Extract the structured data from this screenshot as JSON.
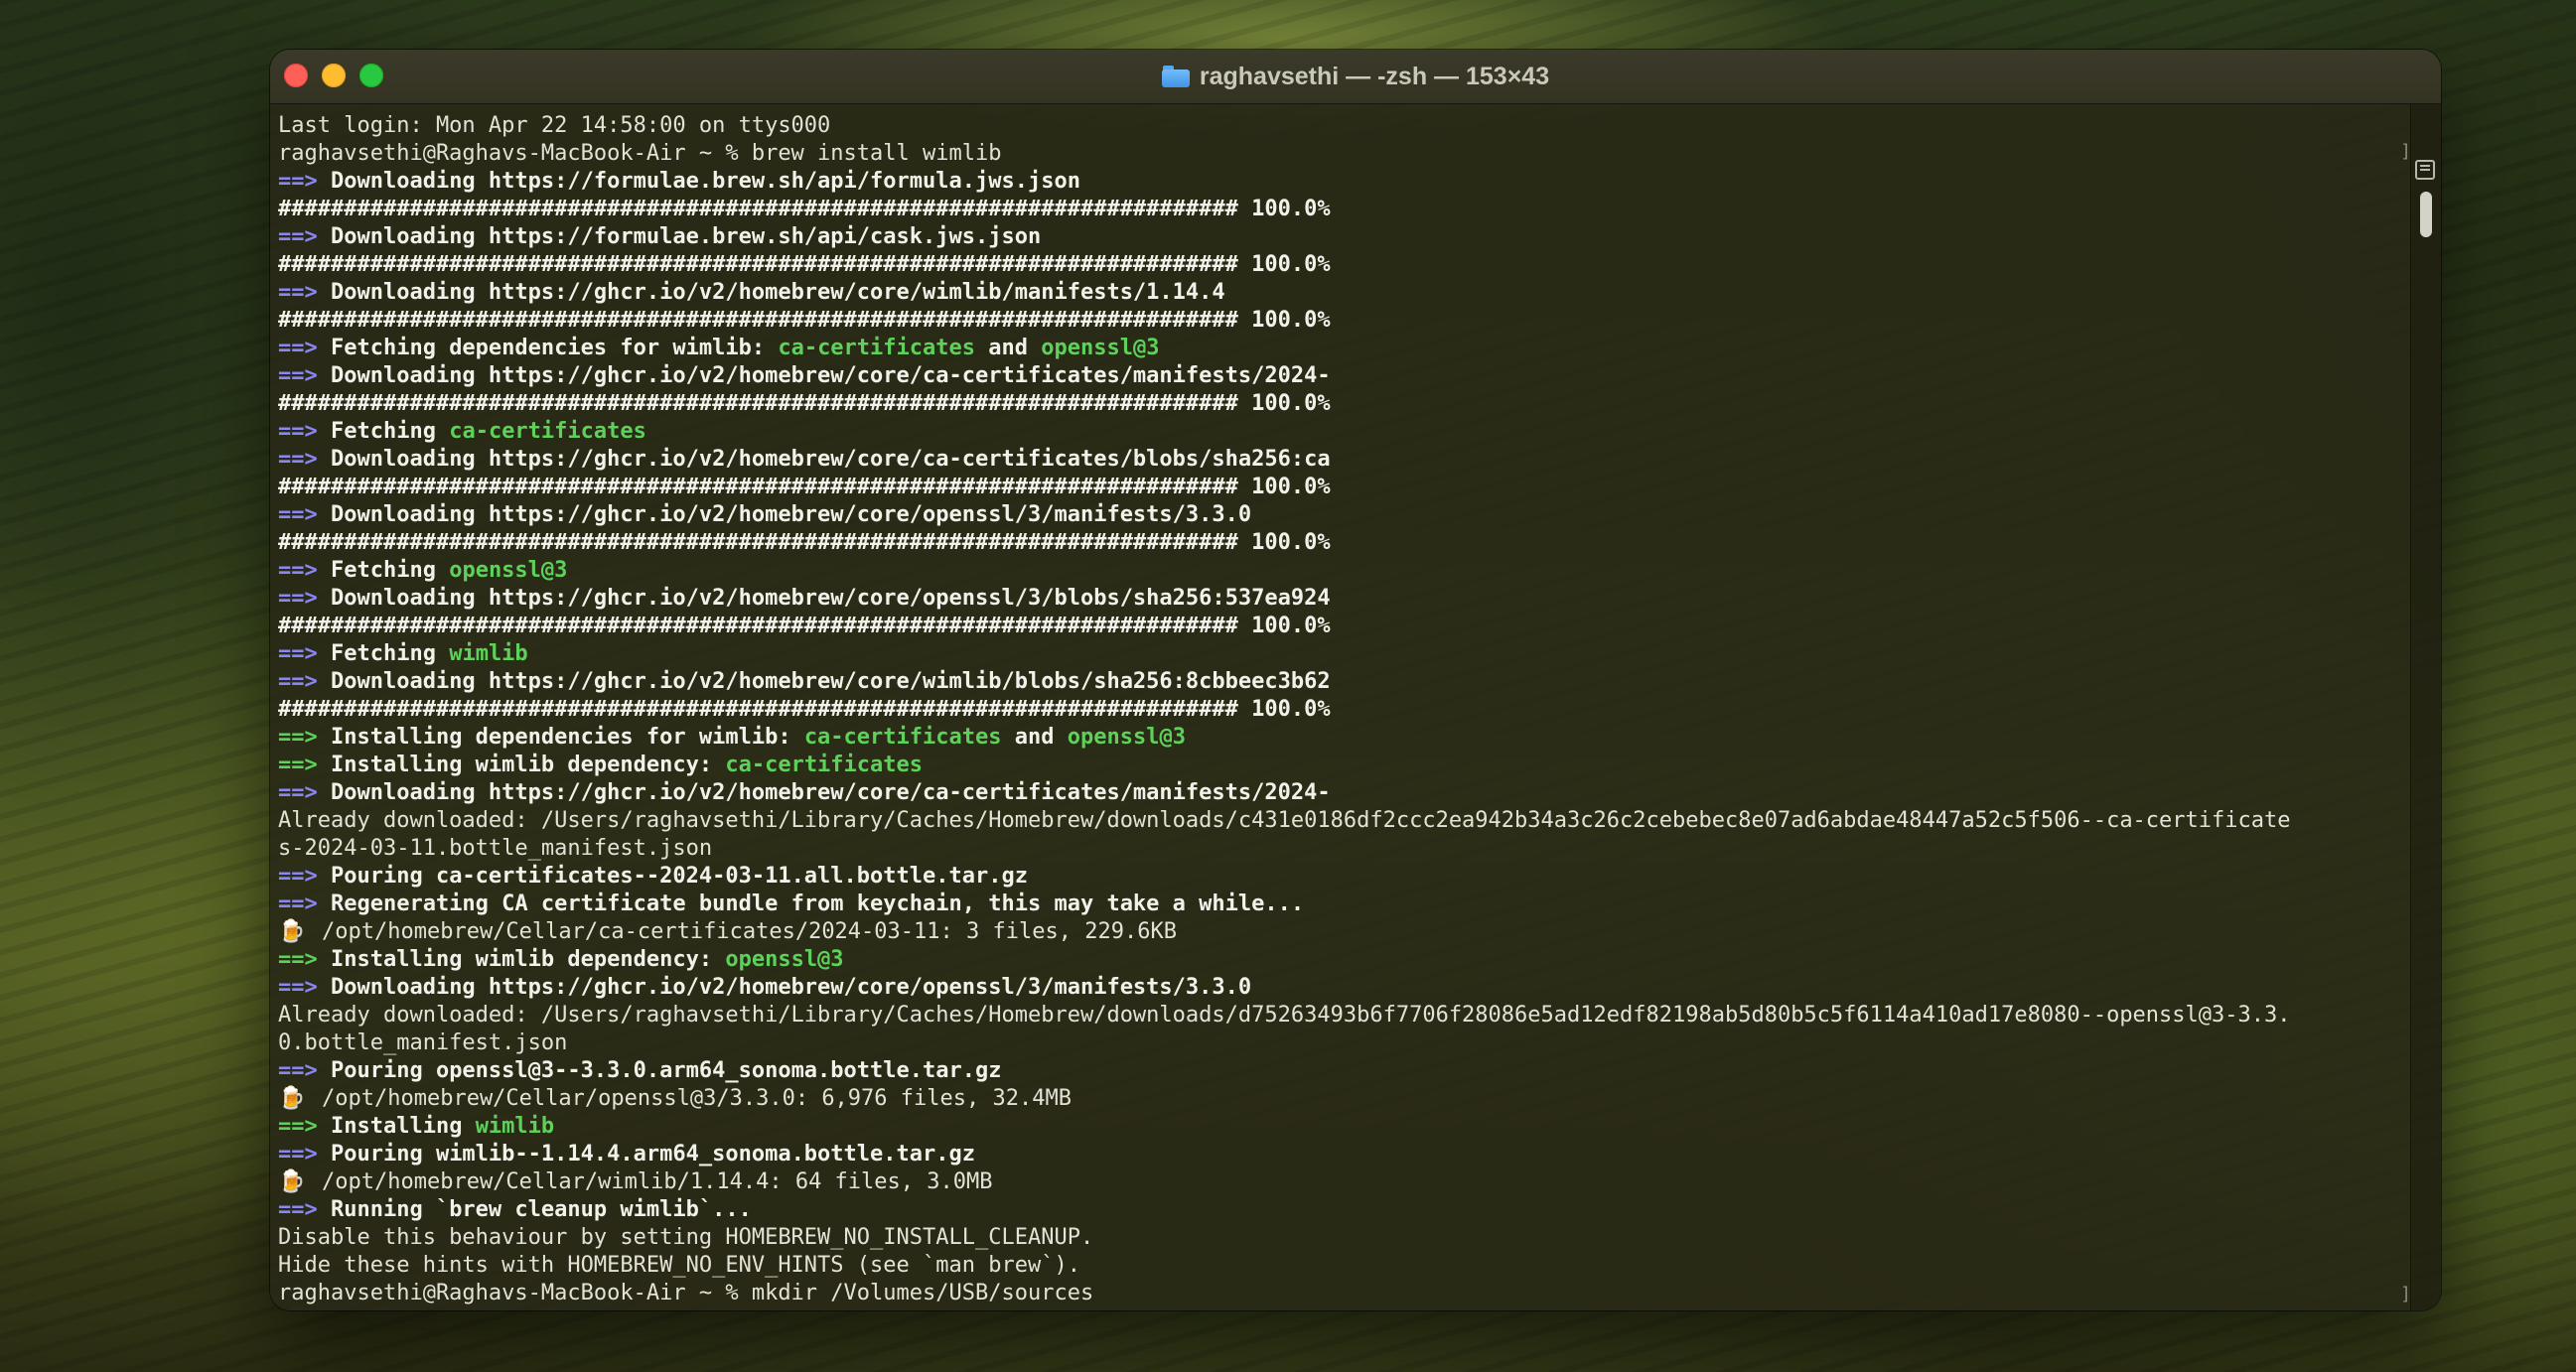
{
  "window": {
    "title": "raghavsethi — -zsh — 153×43",
    "folder_icon": "folder-icon"
  },
  "colors": {
    "arrow": "#8a86f4",
    "highlight": "#5ed15a",
    "text": "#e4e2d6"
  },
  "terminal": {
    "lines": [
      [
        {
          "t": "plain",
          "s": "Last login: Mon Apr 22 14:58:00 on ttys000"
        }
      ],
      [
        {
          "t": "plain",
          "s": "raghavsethi@Raghavs-MacBook-Air ~ % brew install wimlib"
        }
      ],
      [
        {
          "t": "arrow",
          "s": "==> "
        },
        {
          "t": "bold",
          "s": "Downloading https://formulae.brew.sh/api/formula.jws.json"
        }
      ],
      [
        {
          "t": "bold",
          "s": "######################################################################### 100.0%"
        }
      ],
      [
        {
          "t": "arrow",
          "s": "==> "
        },
        {
          "t": "bold",
          "s": "Downloading https://formulae.brew.sh/api/cask.jws.json"
        }
      ],
      [
        {
          "t": "bold",
          "s": "######################################################################### 100.0%"
        }
      ],
      [
        {
          "t": "arrow",
          "s": "==> "
        },
        {
          "t": "bold",
          "s": "Downloading https://ghcr.io/v2/homebrew/core/wimlib/manifests/1.14.4"
        }
      ],
      [
        {
          "t": "bold",
          "s": "######################################################################### 100.0%"
        }
      ],
      [
        {
          "t": "arrow",
          "s": "==> "
        },
        {
          "t": "bold",
          "s": "Fetching dependencies for wimlib: "
        },
        {
          "t": "green",
          "s": "ca-certificates"
        },
        {
          "t": "bold",
          "s": " and "
        },
        {
          "t": "green",
          "s": "openssl@3"
        }
      ],
      [
        {
          "t": "arrow",
          "s": "==> "
        },
        {
          "t": "bold",
          "s": "Downloading https://ghcr.io/v2/homebrew/core/ca-certificates/manifests/2024-"
        }
      ],
      [
        {
          "t": "bold",
          "s": "######################################################################### 100.0%"
        }
      ],
      [
        {
          "t": "arrow",
          "s": "==> "
        },
        {
          "t": "bold",
          "s": "Fetching "
        },
        {
          "t": "green",
          "s": "ca-certificates"
        }
      ],
      [
        {
          "t": "arrow",
          "s": "==> "
        },
        {
          "t": "bold",
          "s": "Downloading https://ghcr.io/v2/homebrew/core/ca-certificates/blobs/sha256:ca"
        }
      ],
      [
        {
          "t": "bold",
          "s": "######################################################################### 100.0%"
        }
      ],
      [
        {
          "t": "arrow",
          "s": "==> "
        },
        {
          "t": "bold",
          "s": "Downloading https://ghcr.io/v2/homebrew/core/openssl/3/manifests/3.3.0"
        }
      ],
      [
        {
          "t": "bold",
          "s": "######################################################################### 100.0%"
        }
      ],
      [
        {
          "t": "arrow",
          "s": "==> "
        },
        {
          "t": "bold",
          "s": "Fetching "
        },
        {
          "t": "green",
          "s": "openssl@3"
        }
      ],
      [
        {
          "t": "arrow",
          "s": "==> "
        },
        {
          "t": "bold",
          "s": "Downloading https://ghcr.io/v2/homebrew/core/openssl/3/blobs/sha256:537ea924"
        }
      ],
      [
        {
          "t": "bold",
          "s": "######################################################################### 100.0%"
        }
      ],
      [
        {
          "t": "arrow",
          "s": "==> "
        },
        {
          "t": "bold",
          "s": "Fetching "
        },
        {
          "t": "green",
          "s": "wimlib"
        }
      ],
      [
        {
          "t": "arrow",
          "s": "==> "
        },
        {
          "t": "bold",
          "s": "Downloading https://ghcr.io/v2/homebrew/core/wimlib/blobs/sha256:8cbbeec3b62"
        }
      ],
      [
        {
          "t": "bold",
          "s": "######################################################################### 100.0%"
        }
      ],
      [
        {
          "t": "green",
          "s": "==> "
        },
        {
          "t": "bold",
          "s": "Installing dependencies for wimlib: "
        },
        {
          "t": "green",
          "s": "ca-certificates"
        },
        {
          "t": "bold",
          "s": " and "
        },
        {
          "t": "green",
          "s": "openssl@3"
        }
      ],
      [
        {
          "t": "green",
          "s": "==> "
        },
        {
          "t": "bold",
          "s": "Installing wimlib dependency: "
        },
        {
          "t": "green",
          "s": "ca-certificates"
        }
      ],
      [
        {
          "t": "arrow",
          "s": "==> "
        },
        {
          "t": "bold",
          "s": "Downloading https://ghcr.io/v2/homebrew/core/ca-certificates/manifests/2024-"
        }
      ],
      [
        {
          "t": "plain",
          "s": "Already downloaded: /Users/raghavsethi/Library/Caches/Homebrew/downloads/c431e0186df2ccc2ea942b34a3c26c2cebebec8e07ad6abdae48447a52c5f506--ca-certificate"
        }
      ],
      [
        {
          "t": "plain",
          "s": "s-2024-03-11.bottle_manifest.json"
        }
      ],
      [
        {
          "t": "arrow",
          "s": "==> "
        },
        {
          "t": "bold",
          "s": "Pouring ca-certificates--2024-03-11.all.bottle.tar.gz"
        }
      ],
      [
        {
          "t": "arrow",
          "s": "==> "
        },
        {
          "t": "bold",
          "s": "Regenerating CA certificate bundle from keychain, this may take a while..."
        }
      ],
      [
        {
          "t": "beer",
          "s": "🍺"
        },
        {
          "t": "plain",
          "s": "/opt/homebrew/Cellar/ca-certificates/2024-03-11: 3 files, 229.6KB"
        }
      ],
      [
        {
          "t": "green",
          "s": "==> "
        },
        {
          "t": "bold",
          "s": "Installing wimlib dependency: "
        },
        {
          "t": "green",
          "s": "openssl@3"
        }
      ],
      [
        {
          "t": "arrow",
          "s": "==> "
        },
        {
          "t": "bold",
          "s": "Downloading https://ghcr.io/v2/homebrew/core/openssl/3/manifests/3.3.0"
        }
      ],
      [
        {
          "t": "plain",
          "s": "Already downloaded: /Users/raghavsethi/Library/Caches/Homebrew/downloads/d75263493b6f7706f28086e5ad12edf82198ab5d80b5c5f6114a410ad17e8080--openssl@3-3.3."
        }
      ],
      [
        {
          "t": "plain",
          "s": "0.bottle_manifest.json"
        }
      ],
      [
        {
          "t": "arrow",
          "s": "==> "
        },
        {
          "t": "bold",
          "s": "Pouring openssl@3--3.3.0.arm64_sonoma.bottle.tar.gz"
        }
      ],
      [
        {
          "t": "beer",
          "s": "🍺"
        },
        {
          "t": "plain",
          "s": "/opt/homebrew/Cellar/openssl@3/3.3.0: 6,976 files, 32.4MB"
        }
      ],
      [
        {
          "t": "green",
          "s": "==> "
        },
        {
          "t": "bold",
          "s": "Installing "
        },
        {
          "t": "green",
          "s": "wimlib"
        }
      ],
      [
        {
          "t": "arrow",
          "s": "==> "
        },
        {
          "t": "bold",
          "s": "Pouring wimlib--1.14.4.arm64_sonoma.bottle.tar.gz"
        }
      ],
      [
        {
          "t": "beer",
          "s": "🍺"
        },
        {
          "t": "plain",
          "s": "/opt/homebrew/Cellar/wimlib/1.14.4: 64 files, 3.0MB"
        }
      ],
      [
        {
          "t": "arrow",
          "s": "==> "
        },
        {
          "t": "bold",
          "s": "Running `brew cleanup wimlib`..."
        }
      ],
      [
        {
          "t": "plain",
          "s": "Disable this behaviour by setting HOMEBREW_NO_INSTALL_CLEANUP."
        }
      ],
      [
        {
          "t": "plain",
          "s": "Hide these hints with HOMEBREW_NO_ENV_HINTS (see `man brew`)."
        }
      ],
      [
        {
          "t": "plain",
          "s": "raghavsethi@Raghavs-MacBook-Air ~ % mkdir /Volumes/USB/sources"
        }
      ]
    ]
  }
}
